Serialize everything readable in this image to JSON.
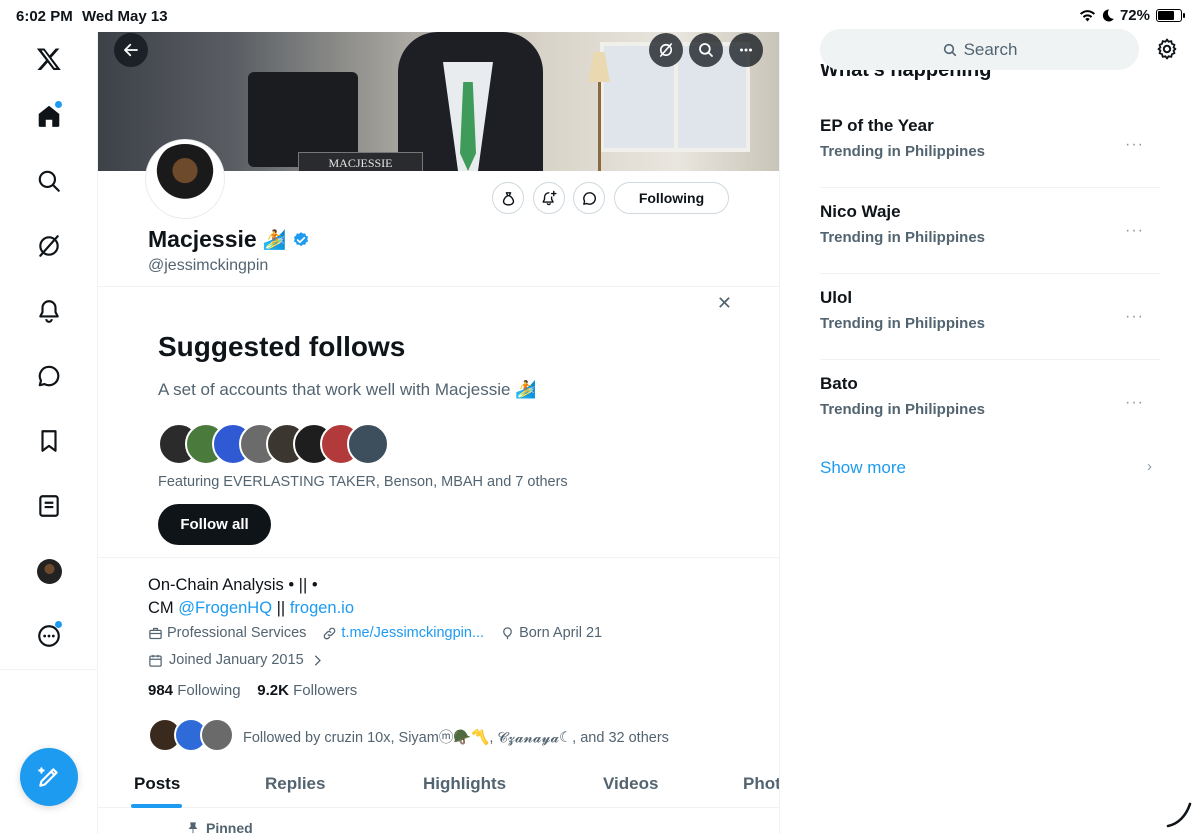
{
  "status": {
    "time": "6:02 PM",
    "date": "Wed May 13",
    "battery": "72%",
    "battery_level": 0.72
  },
  "nav": {
    "items": [
      {
        "name": "x-logo-icon"
      },
      {
        "name": "home-icon"
      },
      {
        "name": "explore-icon"
      },
      {
        "name": "grok-icon"
      },
      {
        "name": "notifications-icon"
      },
      {
        "name": "messages-icon"
      },
      {
        "name": "bookmarks-icon"
      },
      {
        "name": "lists-icon"
      },
      {
        "name": "profile-avatar"
      },
      {
        "name": "more-icon"
      }
    ],
    "accent": "#1d9bf0"
  },
  "banner": {
    "nameplate": "MACJESSIE"
  },
  "profile": {
    "name": "Macjessie",
    "name_emoji": "🏄",
    "handle": "@jessimckingpin",
    "following_button": "Following",
    "bio_line1": "On-Chain Analysis • || •",
    "bio_cm": "CM",
    "bio_mention": "@FrogenHQ",
    "bio_sep": "||",
    "bio_link": "frogen.io",
    "category": "Professional Services",
    "website": "t.me/Jessimckingpin...",
    "born": "Born April 21",
    "joined": "Joined January 2015",
    "following_count": "984",
    "following_label": "Following",
    "followers_count": "9.2K",
    "followers_label": "Followers",
    "followed_by": "Followed by cruzin 10x, Siyamⓜ️🪖〽️, 𝓒𝔃𝓪𝓷𝓪𝔂𝓪☾, and 32 others"
  },
  "suggested": {
    "title": "Suggested follows",
    "subtitle": "A set of accounts that work well with Macjessie 🏄",
    "featuring": "Featuring EVERLASTING TAKER, Benson, MBAH and 7 others",
    "follow_all": "Follow all",
    "close": "✕"
  },
  "tabs": [
    {
      "label": "Posts",
      "active": true
    },
    {
      "label": "Replies"
    },
    {
      "label": "Highlights"
    },
    {
      "label": "Videos"
    },
    {
      "label": "Phot"
    }
  ],
  "pinned": "Pinned",
  "right": {
    "search_placeholder": "Search",
    "heading": "What's happening",
    "trends": [
      {
        "title": "EP of the Year",
        "context": "Trending in Philippines"
      },
      {
        "title": "Nico Waje",
        "context": "Trending in Philippines"
      },
      {
        "title": "Ulol",
        "context": "Trending in Philippines"
      },
      {
        "title": "Bato",
        "context": "Trending in Philippines"
      }
    ],
    "show_more": "Show more",
    "more_glyph": "···"
  }
}
